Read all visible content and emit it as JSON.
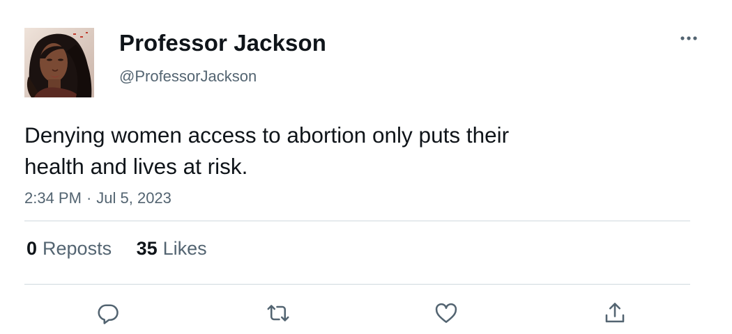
{
  "author": {
    "display_name": "Professor Jackson",
    "handle": "@ProfessorJackson",
    "avatar_icon": "profile-photo"
  },
  "tweet": {
    "text": "Denying women access to abortion only puts their\nhealth and lives at risk.",
    "time": "2:34 PM",
    "separator": "·",
    "date": "Jul 5, 2023"
  },
  "stats": {
    "reposts_count": "0",
    "reposts_label": "Reposts",
    "likes_count": "35",
    "likes_label": "Likes"
  },
  "icons": {
    "more": "more-horizontal-icon",
    "reply": "reply-icon",
    "repost": "repost-icon",
    "like": "heart-icon",
    "share": "share-icon"
  },
  "colors": {
    "text_primary": "#0f1419",
    "text_secondary": "#536471",
    "divider": "#cfd9de"
  }
}
